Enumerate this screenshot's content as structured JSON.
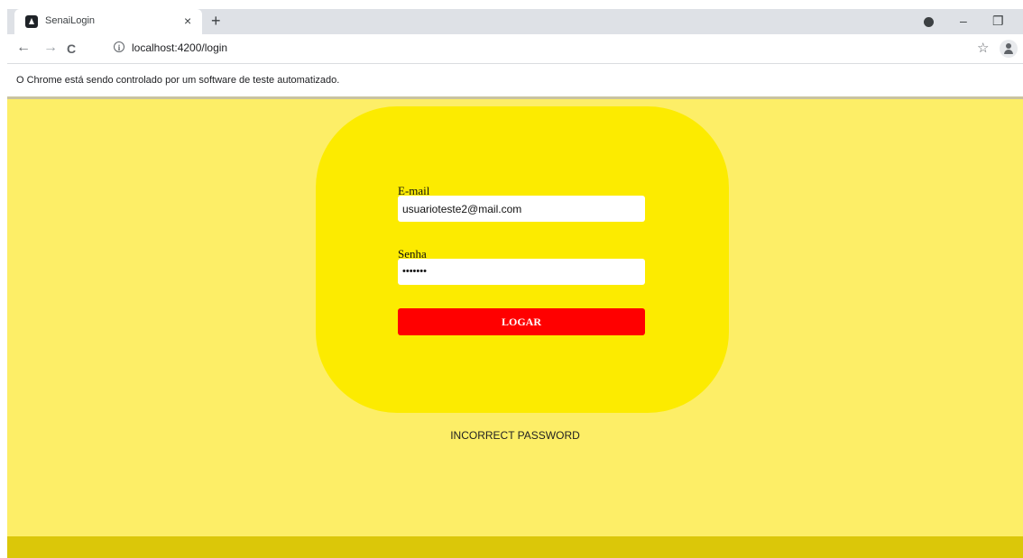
{
  "browser": {
    "tab_title": "SenaiLogin",
    "tab_close": "×",
    "new_tab": "+",
    "url": "localhost:4200/login",
    "info_icon": "i",
    "back_glyph": "←",
    "forward_glyph": "→",
    "reload_glyph": "C",
    "star_glyph": "☆",
    "minimize_glyph": "–",
    "restore_glyph": "❐",
    "automation_notice": "O Chrome está sendo controlado por um software de teste automatizado."
  },
  "login": {
    "email_label": "E-mail",
    "email_value": "usuarioteste2@mail.com",
    "password_label": "Senha",
    "password_value": "•••••••",
    "submit_label": "LOGAR",
    "error_message": "INCORRECT PASSWORD"
  },
  "colors": {
    "page_bg": "#fdee67",
    "card_bg": "#fceb00",
    "button_bg": "#ff0000",
    "footer_bg": "#dbc709"
  }
}
